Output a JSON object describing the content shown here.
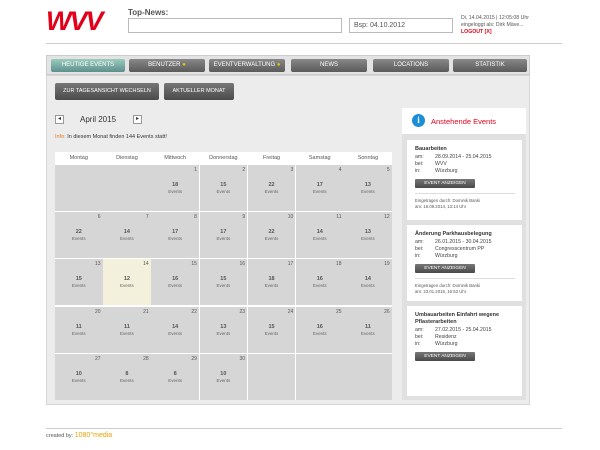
{
  "header": {
    "logo_text": "WVV",
    "topnews_label": "Top-News:",
    "date_placeholder": "Bsp: 04.10.2012",
    "datetime": "Di, 14.04.2015 | 12:05:08 Uhr",
    "logged_in_label": "eingeloggt als: Dirk Mäve...",
    "logout": "LOGOUT [X]"
  },
  "nav": {
    "tabs": [
      {
        "label": "Heutige Events",
        "active": true,
        "badge": false
      },
      {
        "label": "Benutzer",
        "active": false,
        "badge": true
      },
      {
        "label": "Eventverwaltung",
        "active": false,
        "badge": true
      },
      {
        "label": "News",
        "active": false,
        "badge": false
      },
      {
        "label": "Locations",
        "active": false,
        "badge": false
      },
      {
        "label": "Statistik",
        "active": false,
        "badge": false
      }
    ]
  },
  "toolbar": {
    "day_view_button": "Zur Tagesansicht wechseln",
    "current_month_button": "Aktueller Monat"
  },
  "calendar": {
    "month_label": "April 2015",
    "prev_arrow": "◂",
    "next_arrow": "▸",
    "info_label": "Info:",
    "info_text": "In diesem Monat finden 144 Events statt!",
    "weekdays": [
      "Montag",
      "Dienstag",
      "Mittwoch",
      "Donnerstag",
      "Freitag",
      "Samstag",
      "Sonntag"
    ],
    "events_word": "Events",
    "weeks": [
      [
        null,
        null,
        {
          "day": "1",
          "count": "18"
        },
        {
          "day": "2",
          "count": "15"
        },
        {
          "day": "3",
          "count": "22"
        },
        {
          "day": "4",
          "count": "17"
        },
        {
          "day": "5",
          "count": "13"
        }
      ],
      [
        {
          "day": "6",
          "count": "22"
        },
        {
          "day": "7",
          "count": "14"
        },
        {
          "day": "8",
          "count": "17"
        },
        {
          "day": "9",
          "count": "17"
        },
        {
          "day": "10",
          "count": "22"
        },
        {
          "day": "11",
          "count": "14"
        },
        {
          "day": "12",
          "count": "13"
        }
      ],
      [
        {
          "day": "13",
          "count": "15"
        },
        {
          "day": "14",
          "count": "12",
          "today": true
        },
        {
          "day": "15",
          "count": "16"
        },
        {
          "day": "16",
          "count": "15"
        },
        {
          "day": "17",
          "count": "18"
        },
        {
          "day": "18",
          "count": "16"
        },
        {
          "day": "19",
          "count": "14"
        }
      ],
      [
        {
          "day": "20",
          "count": "11"
        },
        {
          "day": "21",
          "count": "11"
        },
        {
          "day": "22",
          "count": "14"
        },
        {
          "day": "23",
          "count": "13"
        },
        {
          "day": "24",
          "count": "15"
        },
        {
          "day": "25",
          "count": "16"
        },
        {
          "day": "26",
          "count": "11"
        }
      ],
      [
        {
          "day": "27",
          "count": "10"
        },
        {
          "day": "28",
          "count": "8"
        },
        {
          "day": "29",
          "count": "8"
        },
        {
          "day": "30",
          "count": "10"
        },
        null,
        null,
        null
      ]
    ]
  },
  "sidebar": {
    "title": "Anstehende Events",
    "button_label": "Event anzeigen",
    "events": [
      {
        "title": "Bauarbeiten",
        "am_label": "am:",
        "am": "28.09.2014 - 25.04.2015",
        "bei_label": "bei:",
        "bei": "WVV",
        "in_label": "in:",
        "in": "Würzburg",
        "entered_by": "Eingetragen durch: Dominik Banki",
        "entered_at": "am: 16.09.2014, 13:14 Uhr"
      },
      {
        "title": "Änderung Parkhausbelegung",
        "am_label": "am:",
        "am": "26.01.2015 - 30.04.2015",
        "bei_label": "bei:",
        "bei": "Congresscentrum PP",
        "in_label": "in:",
        "in": "Würzburg",
        "entered_by": "Eingetragen durch: Dominik Banki",
        "entered_at": "am: 23.01.2015, 16:53 Uhr"
      },
      {
        "title": "Umbauarbeiten Einfahrt wegene Pflasterarbeiten",
        "am_label": "am:",
        "am": "27.02.2015 - 25.04.2015",
        "bei_label": "bei:",
        "bei": "Residenz",
        "in_label": "in:",
        "in": "Würzburg"
      }
    ]
  },
  "footer": {
    "created_by": "created by:",
    "brand": "1080°media"
  },
  "colors": {
    "brand_red": "#e3001b",
    "info_blue": "#1a8fd6",
    "orange": "#e87a1e",
    "active_tab": "#5e8f8f"
  }
}
